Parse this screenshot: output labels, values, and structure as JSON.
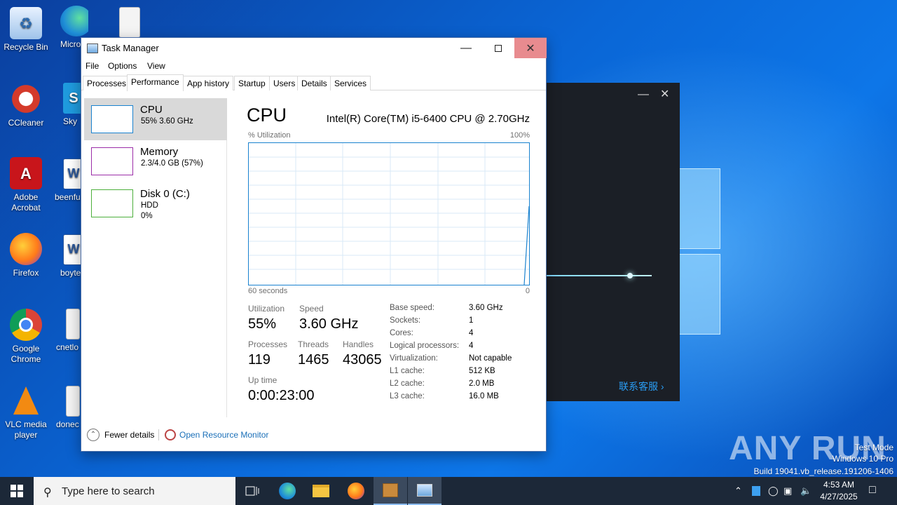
{
  "desktop": {
    "icons": [
      {
        "label": "Recycle Bin",
        "icon": "recycle-bin-icon"
      },
      {
        "label": "CCleaner",
        "icon": "ccleaner-icon"
      },
      {
        "label": "Adobe Acrobat",
        "icon": "adobe-acrobat-icon"
      },
      {
        "label": "Firefox",
        "icon": "firefox-icon"
      },
      {
        "label": "Google Chrome",
        "icon": "chrome-icon"
      },
      {
        "label": "VLC media player",
        "icon": "vlc-icon"
      }
    ],
    "partial_icons": [
      {
        "label": "Micro Ed",
        "icon": "edge-icon"
      },
      {
        "label": "Sky",
        "icon": "skype-icon"
      },
      {
        "label": "beenfu",
        "icon": "word-doc-icon"
      },
      {
        "label": "boyte",
        "icon": "word-doc-icon"
      },
      {
        "label": "cnetlo",
        "icon": "image-file-icon"
      },
      {
        "label": "donec",
        "icon": "image-file-icon"
      }
    ]
  },
  "background_window": {
    "link_text": "联系客服 ›"
  },
  "task_manager": {
    "title": "Task Manager",
    "menu": [
      "File",
      "Options",
      "View"
    ],
    "tabs": [
      "Processes",
      "Performance",
      "App history",
      "Startup",
      "Users",
      "Details",
      "Services"
    ],
    "active_tab": "Performance",
    "sidebar": [
      {
        "name": "CPU",
        "line1": "55%  3.60 GHz",
        "line2": "",
        "color": "#1a82cf",
        "selected": true
      },
      {
        "name": "Memory",
        "line1": "2.3/4.0 GB (57%)",
        "line2": "",
        "color": "#9b2da8",
        "selected": false
      },
      {
        "name": "Disk 0 (C:)",
        "line1": "HDD",
        "line2": "0%",
        "color": "#4caf3c",
        "selected": false
      }
    ],
    "cpu": {
      "title": "CPU",
      "model": "Intel(R) Core(TM) i5-6400 CPU @ 2.70GHz",
      "graph_label": "% Utilization",
      "graph_max": "100%",
      "graph_time": "60 seconds",
      "graph_min": "0",
      "utilization_label": "Utilization",
      "utilization": "55%",
      "speed_label": "Speed",
      "speed": "3.60 GHz",
      "processes_label": "Processes",
      "processes": "119",
      "threads_label": "Threads",
      "threads": "1465",
      "handles_label": "Handles",
      "handles": "43065",
      "uptime_label": "Up time",
      "uptime": "0:00:23:00",
      "specs": [
        {
          "label": "Base speed:",
          "value": "3.60 GHz"
        },
        {
          "label": "Sockets:",
          "value": "1"
        },
        {
          "label": "Cores:",
          "value": "4"
        },
        {
          "label": "Logical processors:",
          "value": "4"
        },
        {
          "label": "Virtualization:",
          "value": "Not capable"
        },
        {
          "label": "L1 cache:",
          "value": "512 KB"
        },
        {
          "label": "L2 cache:",
          "value": "2.0 MB"
        },
        {
          "label": "L3 cache:",
          "value": "16.0 MB"
        }
      ]
    },
    "footer": {
      "fewer_details": "Fewer details",
      "open_resource_monitor": "Open Resource Monitor"
    }
  },
  "watermark": {
    "logo": "ANY RUN",
    "line1": "Test Mode",
    "line2": "Windows 10 Pro",
    "line3": "Build 19041.vb_release.191206-1406"
  },
  "taskbar": {
    "search_placeholder": "Type here to search",
    "time": "4:53 AM",
    "date": "4/27/2025"
  }
}
